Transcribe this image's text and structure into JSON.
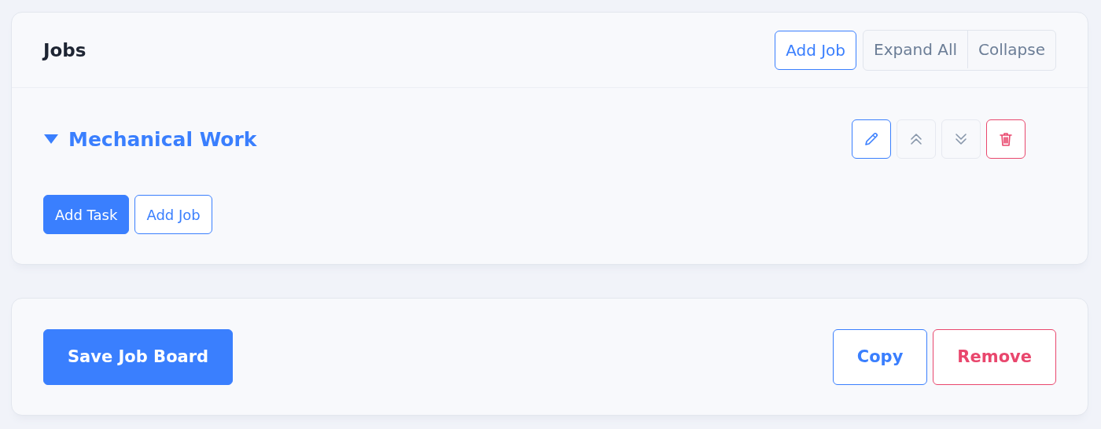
{
  "jobs_panel": {
    "title": "Jobs",
    "header_buttons": [
      {
        "label": "Add Job",
        "kind": "outline"
      }
    ],
    "toggle_group": [
      "Expand All",
      "Collapse"
    ],
    "jobs": [
      {
        "title": "Mechanical Work",
        "expanded": true,
        "buttons": [
          {
            "label": "Add Task",
            "kind": "solid"
          },
          {
            "label": "Add Job",
            "kind": "outline"
          }
        ]
      }
    ]
  },
  "footer": {
    "buttons": [
      {
        "label": "Save Job Board",
        "kind": "solid"
      },
      {
        "label": "Copy",
        "kind": "outline"
      },
      {
        "label": "Remove",
        "kind": "danger"
      }
    ]
  }
}
